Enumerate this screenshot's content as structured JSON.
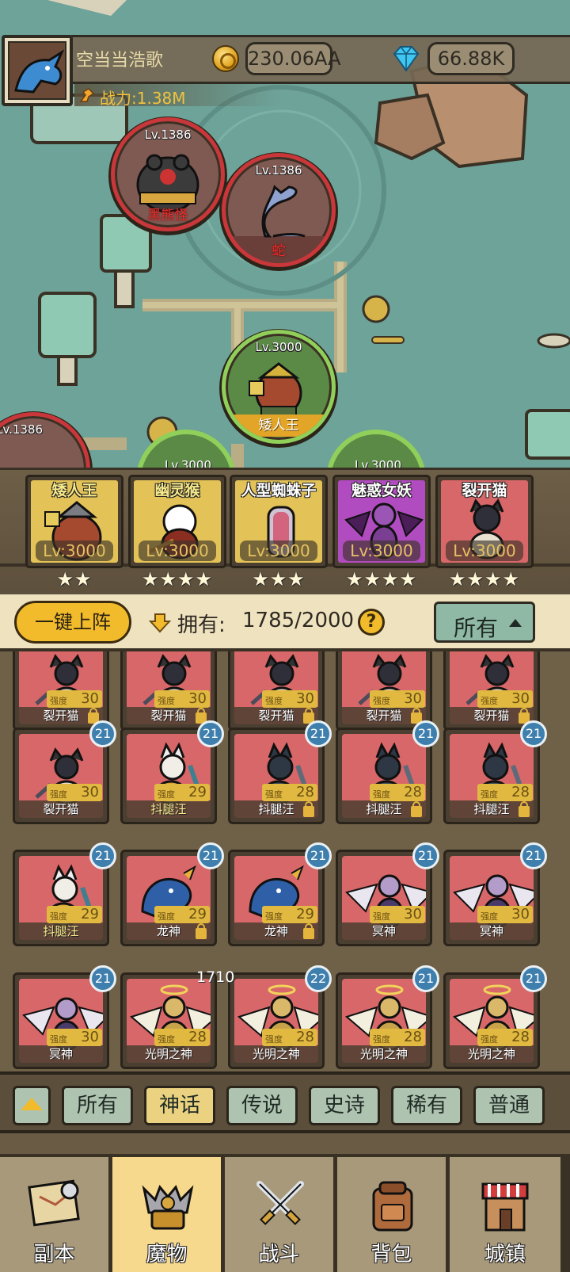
{
  "player": {
    "name": "空当当浩歌",
    "gold": "230.06AA",
    "gems": "66.88K",
    "power": "战力:1.38M"
  },
  "map_nodes": [
    {
      "level": "Lv.1386",
      "name": "黑熊怪",
      "state": "enemy"
    },
    {
      "level": "Lv.1386",
      "name": "蛇",
      "state": "enemy"
    },
    {
      "level": "Lv.3000",
      "name": "矮人王",
      "state": "current"
    },
    {
      "level": "Lv.1386",
      "name": "",
      "state": "enemy"
    }
  ],
  "peek_levels": [
    "Lv.3000",
    "Lv.3000"
  ],
  "team": [
    {
      "name": "矮人王",
      "level": "Lv:3000",
      "stars": "★★",
      "color": "#e3c257"
    },
    {
      "name": "幽灵猴",
      "level": "Lv:3000",
      "stars": "★★★★",
      "color": "#e3c257"
    },
    {
      "name": "人型蜘蛛子",
      "level": "Lv:3000",
      "stars": "★★★",
      "color": "#e3c257"
    },
    {
      "name": "魅惑女妖",
      "level": "Lv:3000",
      "stars": "★★★★",
      "color": "#b14cc0"
    },
    {
      "name": "裂开猫",
      "level": "Lv:3000",
      "stars": "★★★★",
      "color": "#d76768"
    }
  ],
  "toolbar": {
    "one_key": "一键上阵",
    "owned_label": "拥有:",
    "owned_count": "1785/2000",
    "help": "?",
    "filter": "所有"
  },
  "monsters": [
    {
      "name": "裂开猫",
      "strength": "30",
      "locked": true,
      "badge": "",
      "kind": "cat"
    },
    {
      "name": "裂开猫",
      "strength": "30",
      "locked": true,
      "badge": "",
      "kind": "cat"
    },
    {
      "name": "裂开猫",
      "strength": "30",
      "locked": true,
      "badge": "",
      "kind": "cat"
    },
    {
      "name": "裂开猫",
      "strength": "30",
      "locked": true,
      "badge": "",
      "kind": "cat"
    },
    {
      "name": "裂开猫",
      "strength": "30",
      "locked": true,
      "badge": "",
      "kind": "cat"
    },
    {
      "name": "裂开猫",
      "strength": "30",
      "locked": false,
      "badge": "21",
      "kind": "cat"
    },
    {
      "name": "抖腿汪",
      "strength": "29",
      "locked": false,
      "badge": "21",
      "kind": "dog",
      "highlight": true
    },
    {
      "name": "抖腿汪",
      "strength": "28",
      "locked": true,
      "badge": "21",
      "kind": "darkdog"
    },
    {
      "name": "抖腿汪",
      "strength": "28",
      "locked": true,
      "badge": "21",
      "kind": "darkdog"
    },
    {
      "name": "抖腿汪",
      "strength": "28",
      "locked": true,
      "badge": "21",
      "kind": "darkdog"
    },
    {
      "name": "抖腿汪",
      "strength": "29",
      "locked": false,
      "badge": "21",
      "kind": "dog",
      "highlight": true
    },
    {
      "name": "龙神",
      "strength": "29",
      "locked": true,
      "badge": "21",
      "kind": "dragon"
    },
    {
      "name": "龙神",
      "strength": "29",
      "locked": true,
      "badge": "21",
      "kind": "dragon"
    },
    {
      "name": "冥神",
      "strength": "30",
      "locked": false,
      "badge": "21",
      "kind": "dark"
    },
    {
      "name": "冥神",
      "strength": "30",
      "locked": false,
      "badge": "21",
      "kind": "dark"
    },
    {
      "name": "冥神",
      "strength": "30",
      "locked": false,
      "badge": "21",
      "kind": "dark"
    },
    {
      "name": "光明之神",
      "strength": "28",
      "locked": false,
      "badge": "",
      "kind": "light"
    },
    {
      "name": "光明之神",
      "strength": "28",
      "locked": false,
      "badge": "22",
      "kind": "light"
    },
    {
      "name": "光明之神",
      "strength": "28",
      "locked": false,
      "badge": "21",
      "kind": "light"
    },
    {
      "name": "光明之神",
      "strength": "28",
      "locked": false,
      "badge": "21",
      "kind": "light"
    }
  ],
  "strength_label": "强度",
  "floating_number": "1710",
  "rarity_tabs": [
    {
      "label": "所有",
      "selected": false
    },
    {
      "label": "神话",
      "selected": true
    },
    {
      "label": "传说",
      "selected": false
    },
    {
      "label": "史诗",
      "selected": false
    },
    {
      "label": "稀有",
      "selected": false
    },
    {
      "label": "普通",
      "selected": false
    }
  ],
  "nav": [
    {
      "label": "副本",
      "icon": "map-icon",
      "active": false
    },
    {
      "label": "魔物",
      "icon": "monster-icon",
      "active": true
    },
    {
      "label": "战斗",
      "icon": "swords-icon",
      "active": false
    },
    {
      "label": "背包",
      "icon": "backpack-icon",
      "active": false
    },
    {
      "label": "城镇",
      "icon": "shop-icon",
      "active": false
    }
  ],
  "colors": {
    "enemy_ring": "#c9373a",
    "current_ring": "#8fcf5a",
    "gold_accent": "#f2bb2c",
    "card_red": "#d76768",
    "badge_blue": "#3f7fae"
  }
}
